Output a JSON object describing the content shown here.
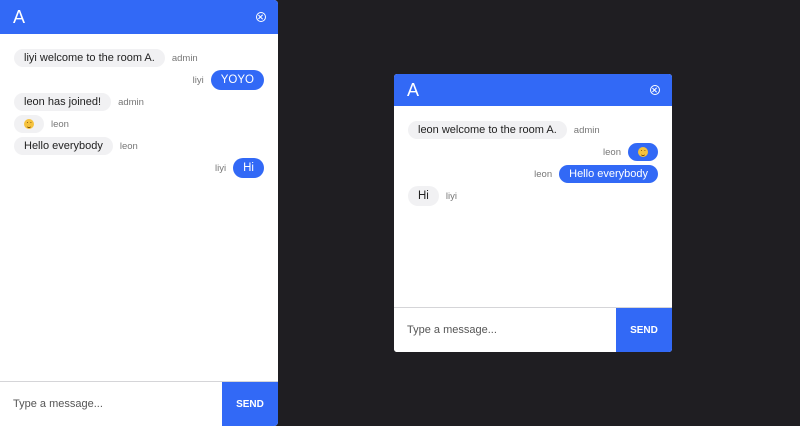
{
  "colors": {
    "accent": "#3269f6",
    "background": "#1f1e22",
    "bubble_in": "#f1f1f3"
  },
  "windows": [
    {
      "title": "A",
      "close_icon": "close-circle-icon",
      "messages": [
        {
          "direction": "in",
          "text": "liyi welcome to the room A.",
          "sender": "admin"
        },
        {
          "direction": "out",
          "text": "YOYO",
          "sender": "liyi"
        },
        {
          "direction": "in",
          "text": "leon has joined!",
          "sender": "admin"
        },
        {
          "direction": "in",
          "emoji": "grinning-emoji-icon",
          "sender": "leon"
        },
        {
          "direction": "in",
          "text": "Hello everybody",
          "sender": "leon"
        },
        {
          "direction": "out",
          "text": "Hi",
          "sender": "liyi"
        }
      ],
      "composer": {
        "placeholder": "Type a message...",
        "value": "",
        "send_label": "SEND"
      }
    },
    {
      "title": "A",
      "close_icon": "close-circle-icon",
      "messages": [
        {
          "direction": "in",
          "text": "leon welcome to the room A.",
          "sender": "admin"
        },
        {
          "direction": "out",
          "emoji": "grinning-emoji-icon",
          "sender": "leon"
        },
        {
          "direction": "out",
          "text": "Hello everybody",
          "sender": "leon"
        },
        {
          "direction": "in",
          "text": "Hi",
          "sender": "liyi"
        }
      ],
      "composer": {
        "placeholder": "Type a message...",
        "value": "",
        "send_label": "SEND"
      }
    }
  ]
}
